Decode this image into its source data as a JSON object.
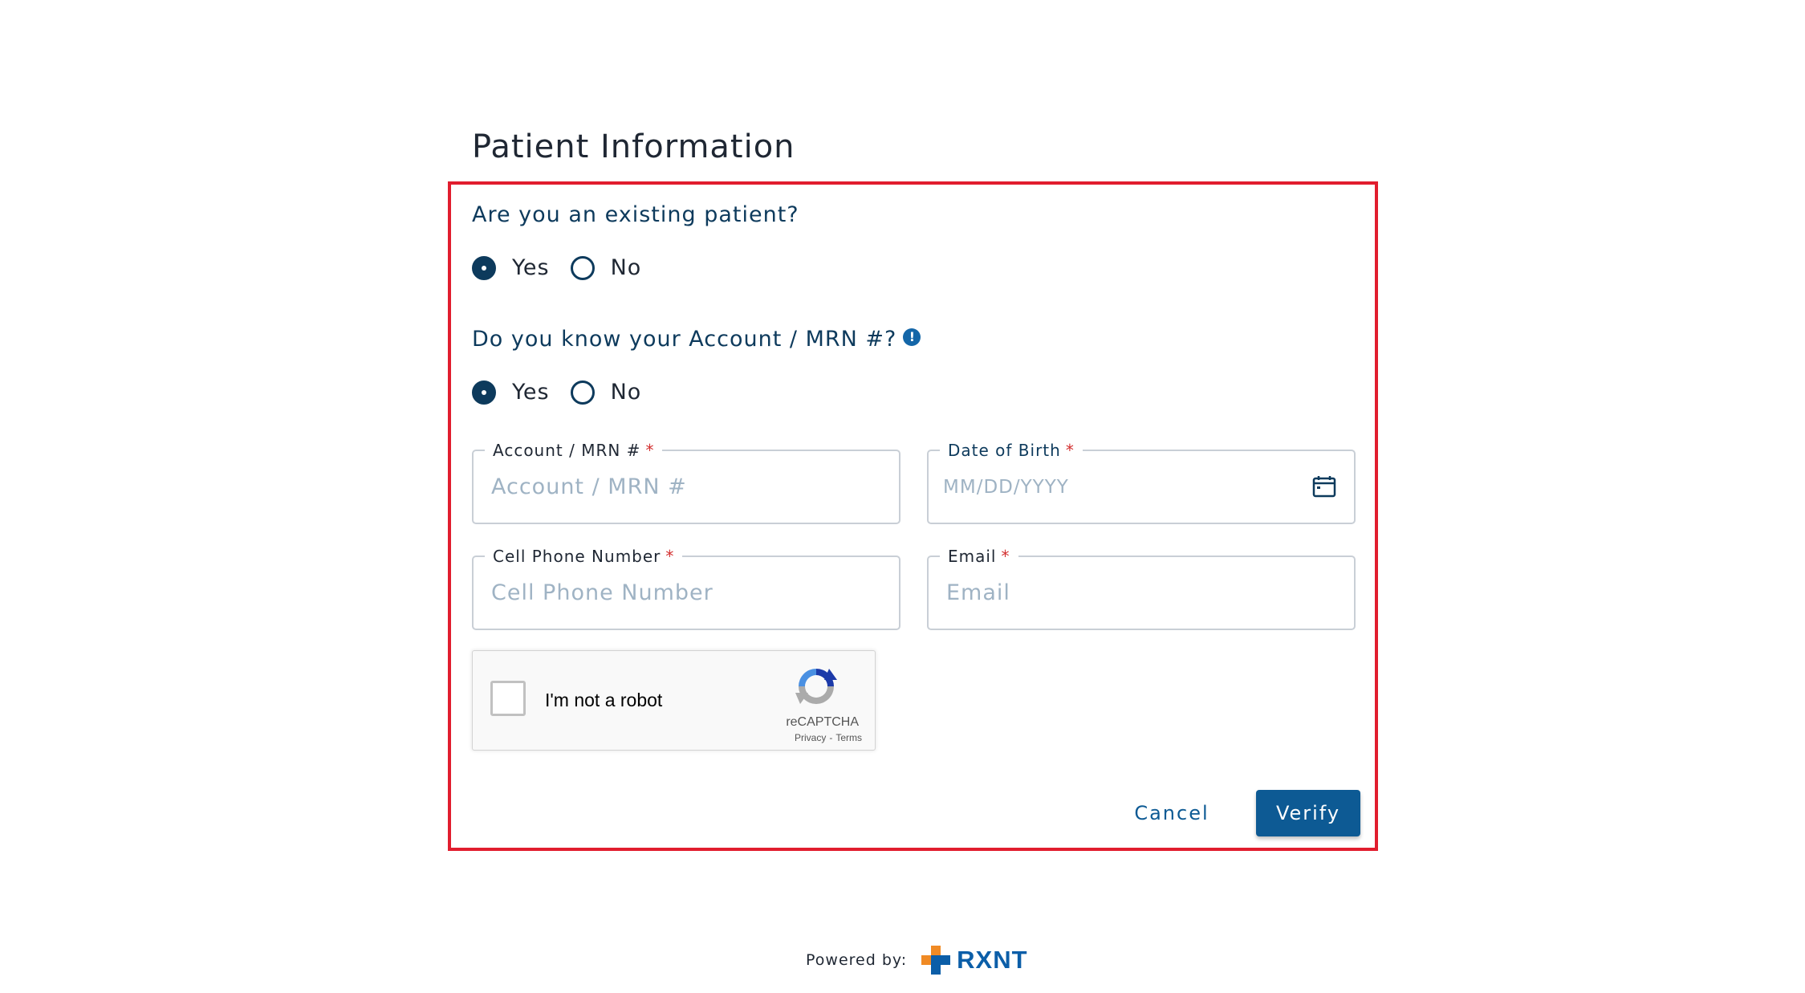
{
  "page": {
    "title": "Patient Information"
  },
  "questions": {
    "existing_patient": {
      "label": "Are you an existing patient?",
      "options": [
        "Yes",
        "No"
      ],
      "selected": "Yes"
    },
    "know_account": {
      "label": "Do you know your Account / MRN #?",
      "info_icon": "info-icon",
      "info_glyph": "!",
      "options": [
        "Yes",
        "No"
      ],
      "selected": "Yes"
    }
  },
  "fields": {
    "account": {
      "label": "Account / MRN #",
      "required_mark": "*",
      "placeholder": "Account / MRN #",
      "value": ""
    },
    "dob": {
      "label": "Date of Birth",
      "required_mark": "*",
      "placeholder": "MM/DD/YYYY",
      "value": "",
      "icon": "calendar-icon"
    },
    "phone": {
      "label": "Cell Phone Number",
      "required_mark": "*",
      "placeholder": "Cell Phone Number",
      "value": ""
    },
    "email": {
      "label": "Email",
      "required_mark": "*",
      "placeholder": "Email",
      "value": ""
    }
  },
  "recaptcha": {
    "label": "I'm not a robot",
    "brand": "reCAPTCHA",
    "privacy": "Privacy",
    "separator": "-",
    "terms": "Terms",
    "checked": false
  },
  "actions": {
    "cancel_label": "Cancel",
    "verify_label": "Verify"
  },
  "footer": {
    "powered_by": "Powered by:",
    "brand_name": "RXNT"
  },
  "colors": {
    "primary": "#0d5a94",
    "heading": "#0d3a5c",
    "highlight_border": "#e11d2e",
    "required": "#d32f2f",
    "brand_orange": "#f08a24",
    "brand_blue": "#0b5ea8"
  }
}
